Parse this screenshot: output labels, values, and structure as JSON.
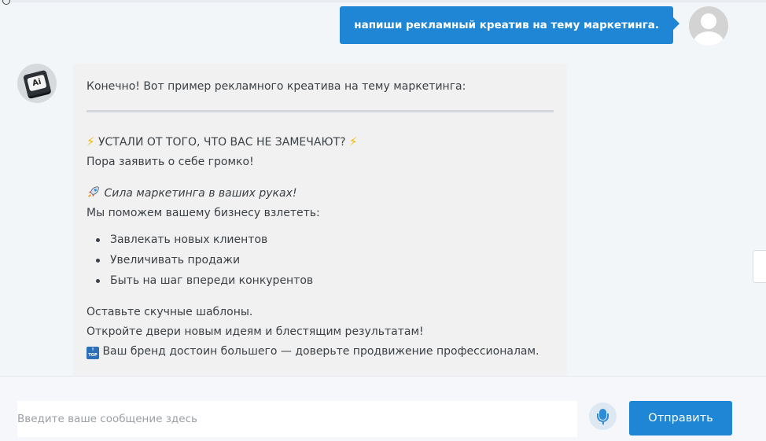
{
  "user_message": {
    "text": "напиши рекламный креатив на тему маркетинга."
  },
  "ai_message": {
    "avatar_label": "Ai",
    "intro": "Конечно! Вот пример рекламного креатива на тему маркетинга:",
    "headline": "УСТАЛИ ОТ ТОГО, ЧТО ВАС НЕ ЗАМЕЧАЮТ?",
    "headline_icon": "lightning-icon",
    "subline": "Пора заявить о себе громко!",
    "feature_icon": "rocket-icon",
    "feature_title": "Сила маркетинга в ваших руках!",
    "feature_sub": "Мы поможем вашему бизнесу взлететь:",
    "bullets": [
      "Завлекать новых клиентов",
      "Увеличивать продажи",
      "Быть на шаг впереди конкурентов"
    ],
    "closing": [
      "Оставьте скучные шаблоны.",
      "Откройте двери новым идеям и блестящим результатам!",
      "Ваш бренд достоин большего — доверьте продвижение профессионалам."
    ],
    "closing_icon": "top-icon",
    "closing_icon_label": "TOP"
  },
  "composer": {
    "placeholder": "Введите ваше сообщение здесь",
    "value": "",
    "mic_icon": "microphone-icon",
    "send_label": "Отправить"
  },
  "colors": {
    "accent": "#1e86d4",
    "bubble": "#f1f1f1",
    "background": "#f3f6f9"
  }
}
